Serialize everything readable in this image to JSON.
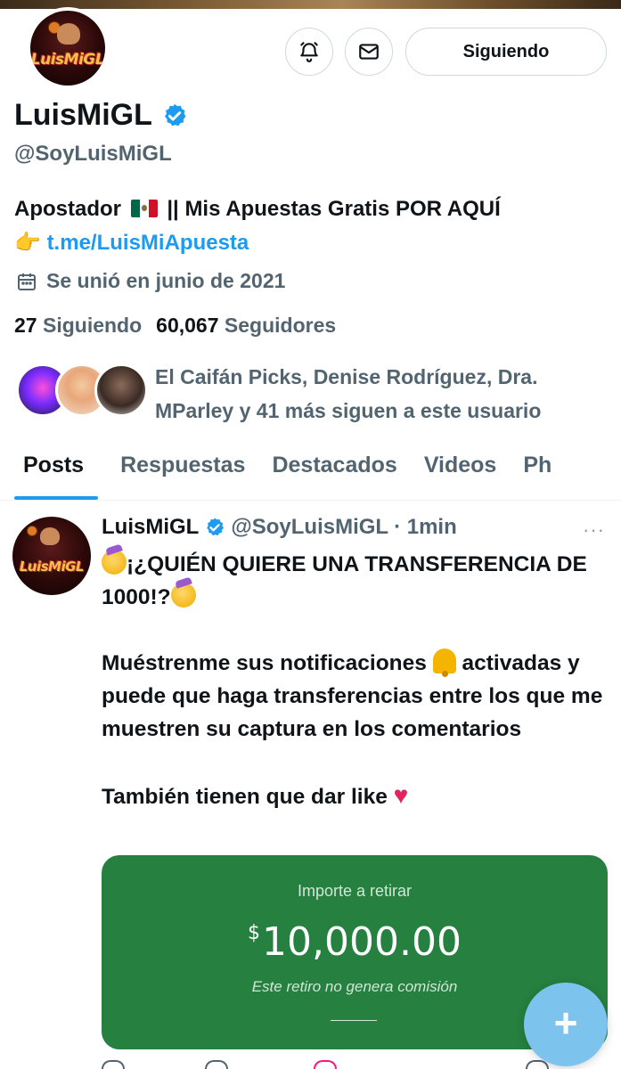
{
  "profile": {
    "name": "LuisMiGL",
    "handle": "@SoyLuisMiGL",
    "avatar_text": "LuisMiGL",
    "bio_text": "Apostador",
    "bio_text2": "|| Mis Apuestas Gratis POR AQUÍ",
    "bio_link": "t.me/LuisMiApuesta",
    "joined": "Se unió en junio de 2021",
    "following_count": "27",
    "following_label": "Siguiendo",
    "followers_count": "60,067",
    "followers_label": "Seguidores",
    "followed_by": "El Caifán Picks, Denise Rodríguez, Dra. MParley y 41 más siguen a este usuario"
  },
  "header": {
    "follow_button": "Siguiendo",
    "notify_icon": "bell-icon",
    "message_icon": "mail-icon"
  },
  "tabs": [
    {
      "label": "Posts",
      "active": true
    },
    {
      "label": "Respuestas"
    },
    {
      "label": "Destacados"
    },
    {
      "label": "Videos"
    },
    {
      "label": "Ph"
    }
  ],
  "post": {
    "author": "LuisMiGL",
    "handle": "@SoyLuisMiGL",
    "time": "· 1min",
    "more": "···",
    "line1": "¡¿QUIÉN QUIERE UNA TRANSFERENCIA DE 1000!?",
    "line2": "Muéstrenme sus notificaciones",
    "line3": "activadas y puede que haga transferencias entre los que me muestren su captura en los comentarios",
    "line4": "También tienen que dar like",
    "media": {
      "label": "Importe a retirar",
      "currency": "$",
      "amount": "10,000.00",
      "note": "Este retiro no genera comisión"
    }
  },
  "fab_label": "+",
  "colors": {
    "accent": "#1d9bf0",
    "muted": "#536471",
    "media_green": "#26803f",
    "fab": "#7cc3ee"
  }
}
